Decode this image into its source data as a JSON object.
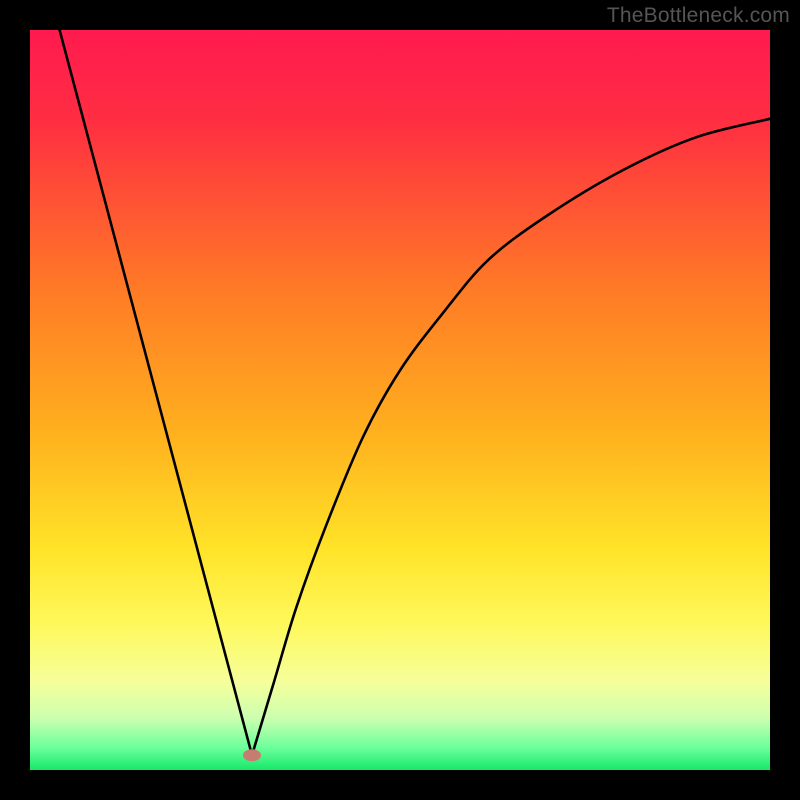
{
  "watermark": "TheBottleneck.com",
  "chart_data": {
    "type": "line",
    "title": "",
    "xlabel": "",
    "ylabel": "",
    "xlim": [
      0,
      100
    ],
    "ylim": [
      0,
      100
    ],
    "background_gradient": {
      "stops": [
        {
          "offset": 0,
          "color": "#ff1a4f"
        },
        {
          "offset": 12,
          "color": "#ff2d42"
        },
        {
          "offset": 35,
          "color": "#ff7a26"
        },
        {
          "offset": 55,
          "color": "#ffb21e"
        },
        {
          "offset": 70,
          "color": "#ffe328"
        },
        {
          "offset": 80,
          "color": "#fff85a"
        },
        {
          "offset": 88,
          "color": "#f6ff9a"
        },
        {
          "offset": 93,
          "color": "#ccffb0"
        },
        {
          "offset": 97,
          "color": "#6bff9a"
        },
        {
          "offset": 100,
          "color": "#17e86a"
        }
      ]
    },
    "series": [
      {
        "name": "left-segment",
        "x": [
          4,
          30
        ],
        "y": [
          100,
          2
        ],
        "mode": "line"
      },
      {
        "name": "right-curve",
        "x": [
          30,
          33,
          36,
          40,
          45,
          50,
          56,
          62,
          70,
          80,
          90,
          100
        ],
        "y": [
          2,
          12,
          22,
          33,
          45,
          54,
          62,
          69,
          75,
          81,
          85.5,
          88
        ],
        "mode": "curve"
      }
    ],
    "marker": {
      "x": 30,
      "y": 2,
      "color": "#c67d6f",
      "rx": 9,
      "ry": 6
    }
  }
}
